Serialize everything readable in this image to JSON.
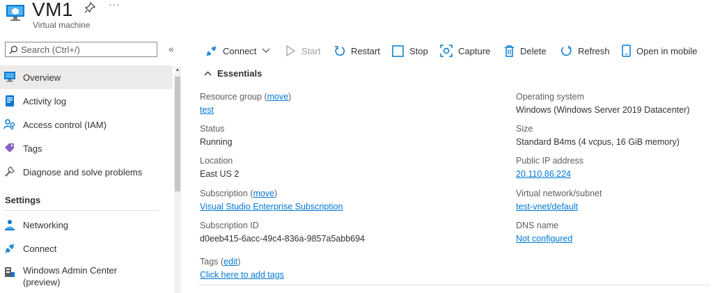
{
  "header": {
    "title": "VM1",
    "subtitle": "Virtual machine",
    "more": "···"
  },
  "search": {
    "placeholder": "Search (Ctrl+/)"
  },
  "collapse": "«",
  "sidebar": {
    "items": [
      {
        "label": "Overview",
        "icon": "overview-icon"
      },
      {
        "label": "Activity log",
        "icon": "activity-log-icon"
      },
      {
        "label": "Access control (IAM)",
        "icon": "access-control-icon"
      },
      {
        "label": "Tags",
        "icon": "tag-icon"
      },
      {
        "label": "Diagnose and solve problems",
        "icon": "wrench-icon"
      }
    ],
    "settings_title": "Settings",
    "settings_items": [
      {
        "label": "Networking",
        "icon": "networking-icon"
      },
      {
        "label": "Connect",
        "icon": "connect-icon"
      },
      {
        "label": "Windows Admin Center",
        "label2": "(preview)",
        "icon": "windows-admin-icon"
      }
    ]
  },
  "toolbar": {
    "connect": "Connect",
    "start": "Start",
    "restart": "Restart",
    "stop": "Stop",
    "capture": "Capture",
    "delete": "Delete",
    "refresh": "Refresh",
    "open_mobile": "Open in mobile"
  },
  "essentials": {
    "title": "Essentials",
    "resource_group_label": "Resource group",
    "move": "move",
    "resource_group": "test",
    "status_label": "Status",
    "status": "Running",
    "location_label": "Location",
    "location": "East US 2",
    "subscription_label": "Subscription",
    "subscription": "Visual Studio Enterprise Subscription",
    "subscription_id_label": "Subscription ID",
    "subscription_id": "d0eeb415-6acc-49c4-836a-9857a5abb694",
    "tags_label": "Tags",
    "edit": "edit",
    "tags_link": "Click here to add tags",
    "os_label": "Operating system",
    "os": "Windows (Windows Server 2019 Datacenter)",
    "size_label": "Size",
    "size": "Standard B4ms (4 vcpus, 16 GiB memory)",
    "public_ip_label": "Public IP address",
    "public_ip": "20.110.86.224",
    "vnet_label": "Virtual network/subnet",
    "vnet": "test-vnet/default",
    "dns_label": "DNS name",
    "dns": "Not configured"
  },
  "colors": {
    "accent": "#0078d4",
    "selected_bg": "#edebe9"
  }
}
